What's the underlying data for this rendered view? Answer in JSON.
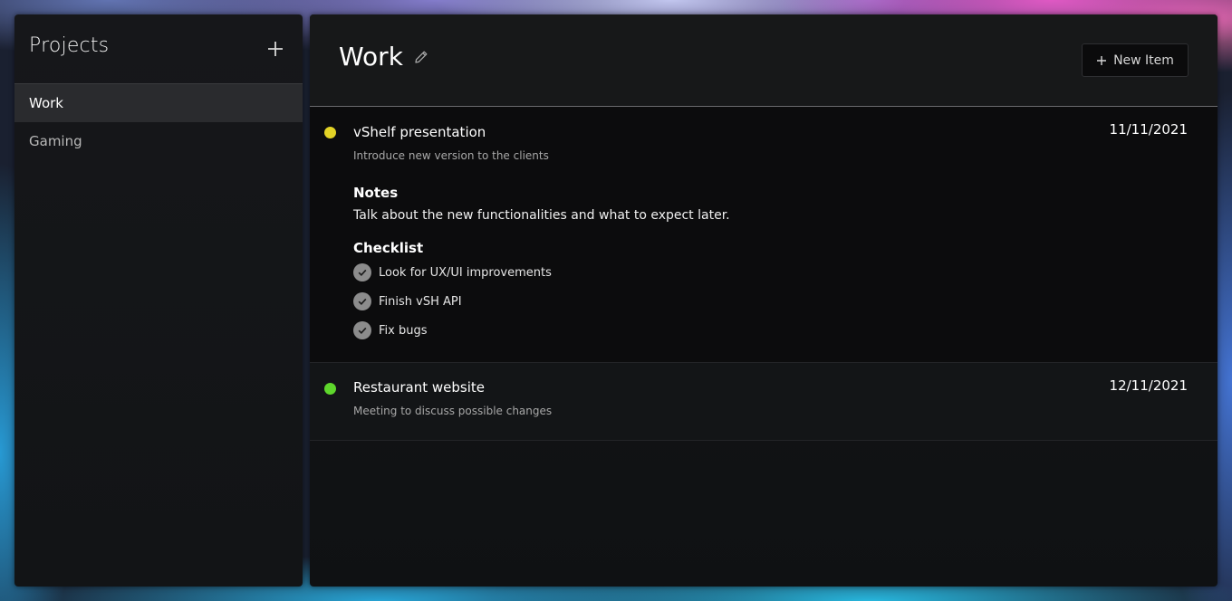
{
  "sidebar": {
    "title": "Projects",
    "add_icon": "plus-icon",
    "items": [
      {
        "label": "Work",
        "active": true
      },
      {
        "label": "Gaming",
        "active": false
      }
    ]
  },
  "main": {
    "title": "Work",
    "edit_icon": "pencil-icon",
    "new_item_label": "New Item",
    "tasks": [
      {
        "title": "vShelf presentation",
        "description": "Introduce new version to the clients",
        "date": "11/11/2021",
        "status_color": "#e3d326",
        "expanded": true,
        "notes_label": "Notes",
        "notes": "Talk about the new functionalities and what to expect later.",
        "checklist_label": "Checklist",
        "checklist": [
          {
            "label": "Look for UX/UI improvements",
            "checked": true
          },
          {
            "label": "Finish vSH API",
            "checked": true
          },
          {
            "label": "Fix bugs",
            "checked": true
          }
        ]
      },
      {
        "title": "Restaurant website",
        "description": "Meeting to discuss possible changes",
        "date": "12/11/2021",
        "status_color": "#5ed62c",
        "expanded": false
      }
    ]
  }
}
